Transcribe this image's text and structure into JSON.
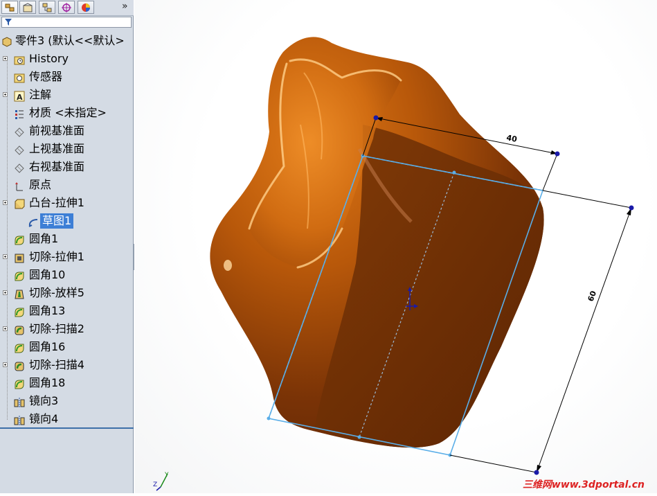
{
  "feature_manager": {
    "filter_icon": "filter-icon",
    "overflow": "»",
    "tabs": [
      {
        "name": "feature-manager-tab",
        "icon": "feature-tree-icon"
      },
      {
        "name": "property-manager-tab",
        "icon": "property-icon"
      },
      {
        "name": "configuration-manager-tab",
        "icon": "configuration-icon"
      },
      {
        "name": "dimxpert-tab",
        "icon": "crosshair-icon"
      },
      {
        "name": "display-manager-tab",
        "icon": "color-wheel-icon"
      }
    ],
    "root": {
      "label": "零件3 (默认<<默认>",
      "icon": "part-icon"
    },
    "items": [
      {
        "label": "History",
        "icon": "history-folder-icon",
        "expandable": true
      },
      {
        "label": "传感器",
        "icon": "sensor-icon",
        "expandable": false
      },
      {
        "label": "注解",
        "icon": "annotation-icon",
        "expandable": true
      },
      {
        "label": "材质 <未指定>",
        "icon": "material-icon",
        "expandable": false
      },
      {
        "label": "前视基准面",
        "icon": "plane-icon",
        "expandable": false
      },
      {
        "label": "上视基准面",
        "icon": "plane-icon",
        "expandable": false
      },
      {
        "label": "右视基准面",
        "icon": "plane-icon",
        "expandable": false
      },
      {
        "label": "原点",
        "icon": "origin-icon",
        "expandable": false
      },
      {
        "label": "凸台-拉伸1",
        "icon": "boss-extrude-icon",
        "expandable": true
      },
      {
        "label": "草图1",
        "icon": "sketch-icon",
        "expandable": false,
        "selected": true
      },
      {
        "label": "圆角1",
        "icon": "fillet-icon",
        "expandable": false
      },
      {
        "label": "切除-拉伸1",
        "icon": "cut-extrude-icon",
        "expandable": true
      },
      {
        "label": "圆角10",
        "icon": "fillet-icon",
        "expandable": false
      },
      {
        "label": "切除-放样5",
        "icon": "cut-loft-icon",
        "expandable": true
      },
      {
        "label": "圆角13",
        "icon": "fillet-icon",
        "expandable": false
      },
      {
        "label": "切除-扫描2",
        "icon": "cut-sweep-icon",
        "expandable": true
      },
      {
        "label": "圆角16",
        "icon": "fillet-icon",
        "expandable": false
      },
      {
        "label": "切除-扫描4",
        "icon": "cut-sweep-icon",
        "expandable": true
      },
      {
        "label": "圆角18",
        "icon": "fillet-icon",
        "expandable": false
      },
      {
        "label": "镜向3",
        "icon": "mirror-icon",
        "expandable": false
      },
      {
        "label": "镜向4",
        "icon": "mirror-icon",
        "expandable": false
      }
    ]
  },
  "graphics": {
    "dimension_width": "40",
    "dimension_height": "60",
    "triad_z": "Z",
    "triad_y": "Y",
    "watermark": "三维网www.3dportal.cn",
    "model_color": "#b55a08",
    "sketch_color": "#5aaee8",
    "dimension_point_color": "#1a1aa8"
  }
}
